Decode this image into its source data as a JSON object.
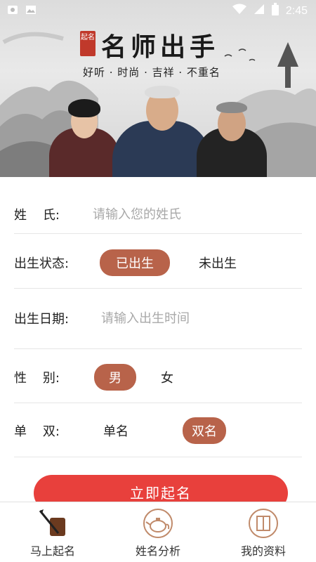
{
  "status_bar": {
    "time": "2:45"
  },
  "banner": {
    "seal_text": "起名",
    "title": "名师出手",
    "subtitle": "好听 · 时尚 · 吉祥 · 不重名"
  },
  "form": {
    "surname": {
      "label": "姓    氏:",
      "placeholder": "请输入您的姓氏",
      "value": ""
    },
    "birth_status": {
      "label": "出生状态:",
      "options": [
        "已出生",
        "未出生"
      ],
      "selected": "已出生"
    },
    "birth_date": {
      "label": "出生日期:",
      "placeholder": "请输入出生时间",
      "value": ""
    },
    "gender": {
      "label": "性    别:",
      "options": [
        "男",
        "女"
      ],
      "selected": "男"
    },
    "name_length": {
      "label": "单    双:",
      "options": [
        "单名",
        "双名"
      ],
      "selected": "双名"
    },
    "submit_label": "立即起名"
  },
  "bottom_nav": {
    "items": [
      {
        "label": "马上起名",
        "icon": "brush-icon"
      },
      {
        "label": "姓名分析",
        "icon": "teapot-icon"
      },
      {
        "label": "我的资料",
        "icon": "book-icon"
      }
    ]
  },
  "colors": {
    "accent": "#b8634a",
    "cta": "#e8403c"
  }
}
